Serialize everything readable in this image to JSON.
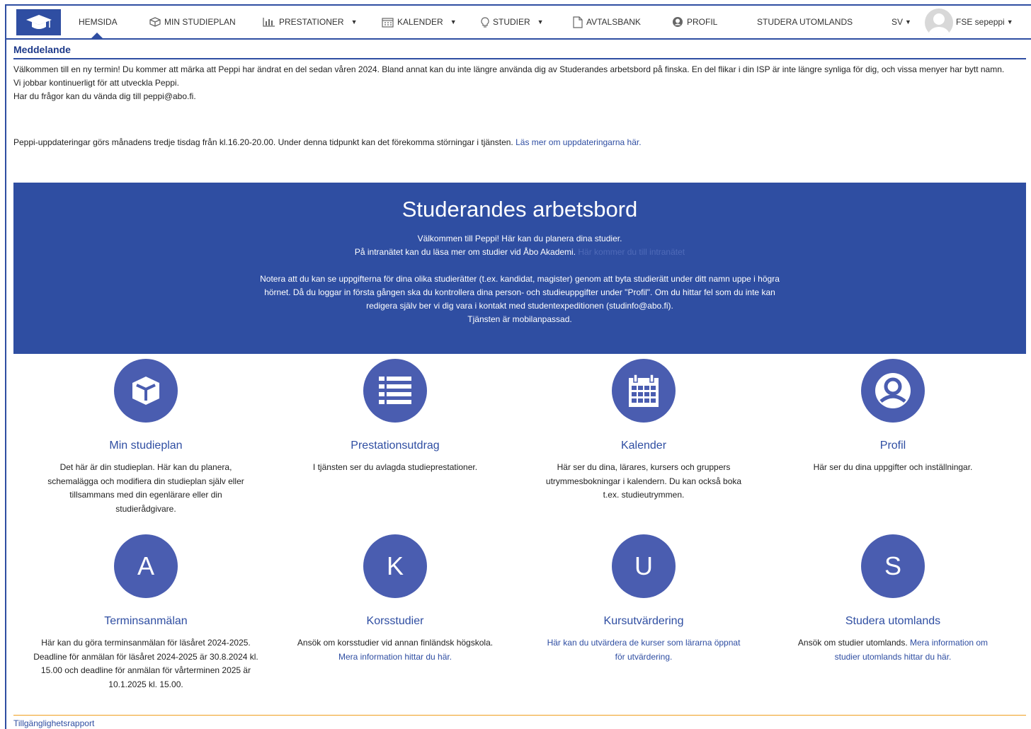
{
  "nav": {
    "items": [
      {
        "label": "HEMSIDA",
        "icon": "none"
      },
      {
        "label": "MIN STUDIEPLAN",
        "icon": "cube-icon"
      },
      {
        "label": "PRESTATIONER",
        "icon": "bar-chart-icon"
      },
      {
        "label": "KALENDER",
        "icon": "calendar-icon"
      },
      {
        "label": "STUDIER",
        "icon": "lightbulb-icon"
      },
      {
        "label": "AVTALSBANK",
        "icon": "document-icon"
      },
      {
        "label": "PROFIL",
        "icon": "user-circle-icon"
      },
      {
        "label": "STUDERA UTOMLANDS",
        "icon": "none"
      }
    ],
    "language": "SV",
    "user": "FSE sepeppi"
  },
  "notice": {
    "title": "Meddelande",
    "line1": "Välkommen till en ny termin! Du kommer att märka att Peppi har ändrat en del sedan våren 2024. Bland annat kan du inte längre använda dig av Studerandes arbetsbord på finska. En del flikar i din ISP är inte längre synliga för dig, och vissa menyer har bytt namn.",
    "line2": "Vi jobbar kontinuerligt för att utveckla Peppi.",
    "line3": "Har du frågor kan du vända dig till peppi@abo.fi.",
    "update_text": "Peppi-uppdateringar görs månadens tredje tisdag från kl.16.20-20.00. Under denna tidpunkt kan det förekomma störningar i tjänsten.",
    "update_link": "Läs mer om uppdateringarna här."
  },
  "banner": {
    "title": "Studerandes arbetsbord",
    "line1": "Välkommen till Peppi! Här kan du planera dina studier.",
    "line2": "På intranätet kan du läsa mer om studier vid Åbo Akademi.",
    "line2_link": "Här kommer du till intranätet",
    "line3": "Notera att du kan se uppgifterna för dina olika studierätter (t.ex. kandidat, magister) genom att byta studierätt under ditt namn uppe i högra",
    "line4": "hörnet. Då du loggar in första gången ska du kontrollera dina person- och studieuppgifter under \"Profil\". Om du hittar fel som du inte kan",
    "line5": "redigera själv ber vi dig vara i kontakt med studentexpeditionen (studinfo@abo.fi).",
    "line6": "Tjänsten är mobilanpassad."
  },
  "tiles": [
    {
      "title": "Min studieplan",
      "icon": "cube-icon",
      "text": "Det här är din studieplan. Här kan du planera, schemalägga och modifiera din studieplan själv eller tillsammans med din egenlärare eller din studierådgivare.",
      "link": ""
    },
    {
      "title": "Prestationsutdrag",
      "icon": "list-icon",
      "text": "I tjänsten ser du avlagda studieprestationer.",
      "link": ""
    },
    {
      "title": "Kalender",
      "icon": "calendar-icon",
      "text": "Här ser du dina, lärares, kursers och gruppers utrymmesbokningar i kalendern. Du kan också boka t.ex. studieutrymmen.",
      "link": ""
    },
    {
      "title": "Profil",
      "icon": "user-circle-icon",
      "text": "Här ser du dina uppgifter och inställningar.",
      "link": ""
    },
    {
      "title": "Terminsanmälan",
      "letter": "A",
      "text": "Här kan du göra terminsanmälan för läsåret 2024-2025. Deadline för anmälan för läsåret 2024-2025 är 30.8.2024 kl. 15.00 och deadline för anmälan för vårterminen 2025 är 10.1.2025 kl. 15.00.",
      "link": ""
    },
    {
      "title": "Korsstudier",
      "letter": "K",
      "text": "Ansök om korsstudier vid annan finländsk högskola.",
      "link": "Mera information hittar du här."
    },
    {
      "title": "Kursutvärdering",
      "letter": "U",
      "text": "",
      "link": "Här kan du utvärdera de kurser som lärarna öppnat för utvärdering."
    },
    {
      "title": "Studera utomlands",
      "letter": "S",
      "text": "Ansök om studier utomlands.",
      "link": "Mera information om studier utomlands hittar du här."
    }
  ],
  "footer": {
    "link": "Tillgänglighetsrapport"
  }
}
